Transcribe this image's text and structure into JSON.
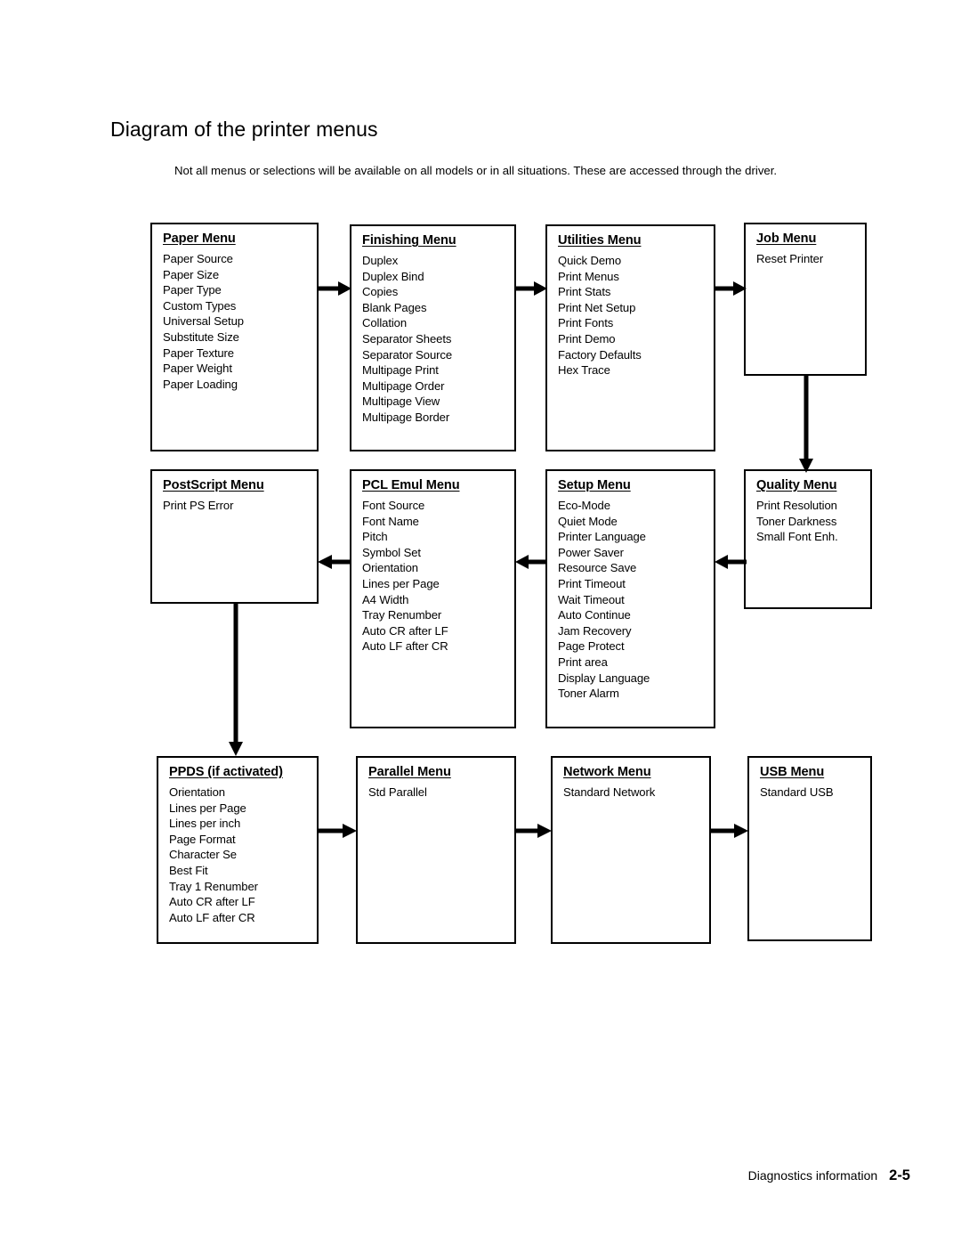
{
  "page": {
    "title": "Diagram of the printer menus",
    "intro": "Not all menus or selections will be available on all models or in all situations. These are accessed through the driver.",
    "footer_text": "Diagnostics information",
    "footer_page": "2-5"
  },
  "menus": [
    {
      "id": "paper-menu",
      "title": "Paper Menu",
      "items": [
        "Paper Source",
        "Paper Size",
        "Paper Type",
        "Custom Types",
        "Universal Setup",
        "Substitute Size",
        "Paper Texture",
        "Paper Weight",
        "Paper Loading"
      ]
    },
    {
      "id": "finishing-menu",
      "title": "Finishing Menu",
      "items": [
        "Duplex",
        "Duplex Bind",
        "Copies",
        "Blank Pages",
        "Collation",
        "Separator Sheets",
        "Separator Source",
        "Multipage Print",
        "Multipage Order",
        "Multipage View",
        "Multipage Border"
      ]
    },
    {
      "id": "utilities-menu",
      "title": "Utilities Menu",
      "items": [
        "Quick Demo",
        "Print Menus",
        "Print Stats",
        "Print Net Setup",
        "Print Fonts",
        "Print Demo",
        "Factory Defaults",
        "Hex Trace"
      ]
    },
    {
      "id": "job-menu",
      "title": "Job Menu",
      "items": [
        "Reset Printer"
      ]
    },
    {
      "id": "postscript-menu",
      "title": "PostScript Menu",
      "items": [
        "Print PS Error"
      ]
    },
    {
      "id": "pcl-emul-menu",
      "title": "PCL Emul Menu",
      "items": [
        "Font Source",
        "Font Name",
        "Pitch",
        "Symbol Set",
        "Orientation",
        "Lines per Page",
        "A4 Width",
        "Tray Renumber",
        "Auto CR after LF",
        "Auto LF after CR"
      ]
    },
    {
      "id": "setup-menu",
      "title": "Setup Menu",
      "items": [
        "Eco-Mode",
        "Quiet Mode",
        "Printer Language",
        "Power Saver",
        "Resource Save",
        "Print Timeout",
        "Wait Timeout",
        "Auto Continue",
        "Jam Recovery",
        "Page Protect",
        "Print area",
        "Display Language",
        "Toner Alarm"
      ]
    },
    {
      "id": "quality-menu",
      "title": "Quality Menu",
      "items": [
        "Print Resolution",
        "Toner Darkness",
        "Small Font Enh."
      ]
    },
    {
      "id": "ppds-menu",
      "title": "PPDS (if activated)",
      "items": [
        "Orientation",
        "Lines per Page",
        "Lines per inch",
        "Page Format",
        "Character Se",
        "Best Fit",
        "Tray 1 Renumber",
        "Auto CR after LF",
        "Auto LF after CR"
      ]
    },
    {
      "id": "parallel-menu",
      "title": "Parallel Menu",
      "items": [
        "Std Parallel"
      ]
    },
    {
      "id": "network-menu",
      "title": "Network Menu",
      "items": [
        "Standard Network"
      ]
    },
    {
      "id": "usb-menu",
      "title": "USB Menu",
      "items": [
        "Standard USB"
      ]
    }
  ]
}
